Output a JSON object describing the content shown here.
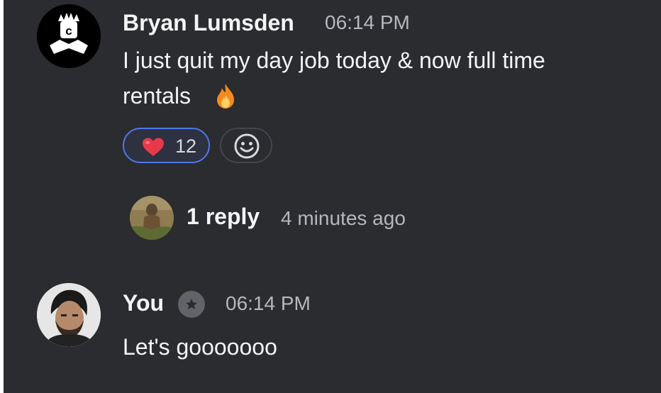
{
  "messages": [
    {
      "author": "Bryan Lumsden",
      "time": "06:14 PM",
      "text_line1": "I just quit my day job today & now full time",
      "text_line2": "rentals",
      "text_emoji": "fire-emoji",
      "reactions": [
        {
          "icon": "heart-emoji",
          "count": "12"
        }
      ],
      "add_reaction_icon": "smiley-icon",
      "replies": {
        "count_label": "1 reply",
        "time": "4 minutes ago"
      }
    },
    {
      "author": "You",
      "badge_icon": "star-badge-icon",
      "time": "06:14 PM",
      "text": "Let's gooooooo"
    }
  ],
  "colors": {
    "background": "#2b2c30",
    "reaction_border": "#4d79e8",
    "heart": "#e8394a",
    "muted_text": "#b6b7bc"
  }
}
